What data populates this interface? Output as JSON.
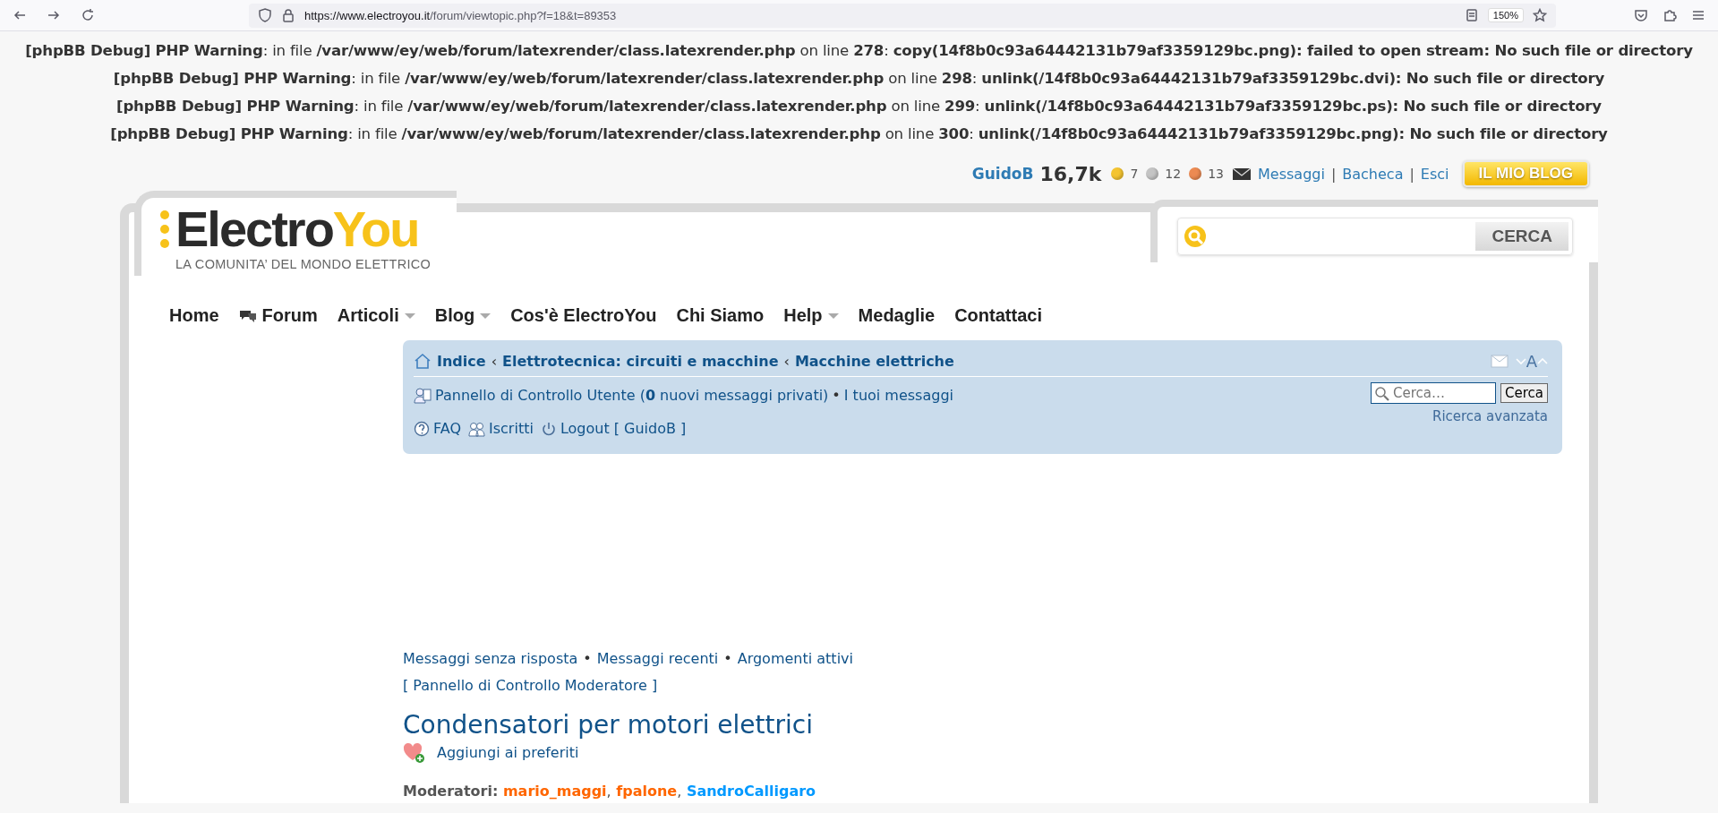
{
  "browser": {
    "url_host": "https://www.electroyou.it",
    "url_path": "/forum/viewtopic.php?f=18&t=89353",
    "zoom": "150%"
  },
  "debug_lines": [
    "**[phpBB Debug] PHP Warning**: in file **/var/www/ey/web/forum/latexrender/class.latexrender.php** on line **278**: **copy(14f8b0c93a64442131b79af3359129bc.png): failed to open stream: No such file or directory**",
    "**[phpBB Debug] PHP Warning**: in file **/var/www/ey/web/forum/latexrender/class.latexrender.php** on line **298**: **unlink(/14f8b0c93a64442131b79af3359129bc.dvi): No such file or directory**",
    "**[phpBB Debug] PHP Warning**: in file **/var/www/ey/web/forum/latexrender/class.latexrender.php** on line **299**: **unlink(/14f8b0c93a64442131b79af3359129bc.ps): No such file or directory**",
    "**[phpBB Debug] PHP Warning**: in file **/var/www/ey/web/forum/latexrender/class.latexrender.php** on line **300**: **unlink(/14f8b0c93a64442131b79af3359129bc.png): No such file or directory**"
  ],
  "user_bar": {
    "username": "GuidoB",
    "score": "16,7k",
    "medals": [
      {
        "count": "7",
        "color": "#f4c430"
      },
      {
        "count": "12",
        "color": "#c4c4c4"
      },
      {
        "count": "13",
        "color": "#ec8a52"
      }
    ],
    "links": [
      "Messaggi",
      "Bacheca",
      "Esci"
    ],
    "separator": "|",
    "blog_button": "IL MIO BLOG"
  },
  "logo": {
    "name_dark": "Electro",
    "name_accent": "You",
    "tagline": "LA COMUNITA’ DEL MONDO ELETTRICO"
  },
  "site_search": {
    "button": "CERCA"
  },
  "nav": [
    {
      "label": "Home",
      "kind": "plain"
    },
    {
      "label": "Forum",
      "kind": "icon"
    },
    {
      "label": "Articoli",
      "kind": "dropdown"
    },
    {
      "label": "Blog",
      "kind": "dropdown"
    },
    {
      "label": "Cos'è ElectroYou",
      "kind": "plain"
    },
    {
      "label": "Chi Siamo",
      "kind": "plain"
    },
    {
      "label": "Help",
      "kind": "dropdown"
    },
    {
      "label": "Medaglie",
      "kind": "plain"
    },
    {
      "label": "Contattaci",
      "kind": "plain"
    }
  ],
  "forum_panel": {
    "breadcrumbs": [
      "Indice",
      "Elettrotecnica: circuiti e macchine",
      "Macchine elettriche"
    ],
    "crumb_separator": "‹",
    "resize_letter": "A",
    "ucp": "Pannello di Controllo Utente (**0** nuovi messaggi privati)",
    "bullet": "•",
    "my_posts": "I tuoi messaggi",
    "links": [
      {
        "label": "FAQ",
        "kind": "faq"
      },
      {
        "label": "Iscritti",
        "kind": "members"
      },
      {
        "label": "Logout [ GuidoB ]",
        "kind": "logout"
      }
    ],
    "search": {
      "placeholder": "Cerca…",
      "button": "Cerca",
      "advanced": "Ricerca avanzata"
    }
  },
  "quick_links": [
    "Messaggi senza risposta",
    "Messaggi recenti",
    "Argomenti attivi"
  ],
  "quick_separator": "•",
  "mcp_link": "[ Pannello di Controllo Moderatore ]",
  "topic_title": "Condensatori per motori elettrici",
  "bookmark": "Aggiungi ai preferiti",
  "moderators": {
    "label": "Moderatori:",
    "separator": ",",
    "names": [
      {
        "name": "mario_maggi",
        "color": "#ff6600"
      },
      {
        "name": "fpalone",
        "color": "#ff6600"
      },
      {
        "name": "SandroCalligaro",
        "color": "#0099ff"
      }
    ]
  }
}
